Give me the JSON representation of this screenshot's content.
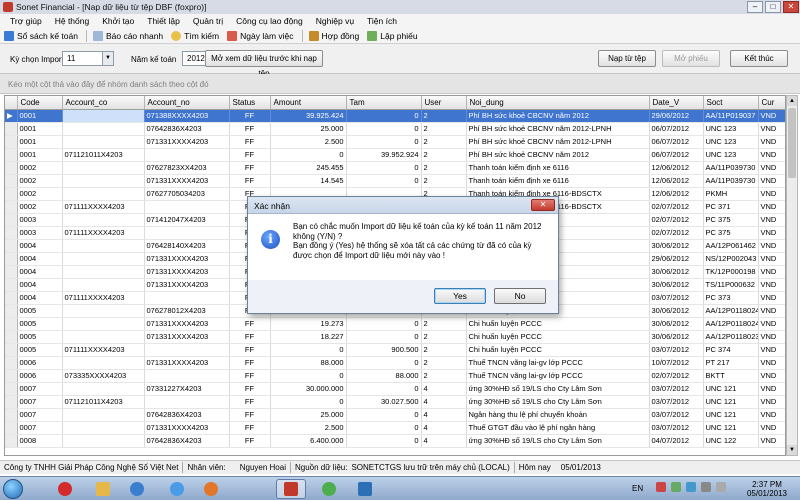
{
  "window": {
    "title": "Sonet Financial - [Nap dữ liệu từ tệp DBF (foxpro)]"
  },
  "menu": [
    "Trợ giúp",
    "Hệ thống",
    "Khởi tạo",
    "Thiết lập",
    "Quản trị",
    "Công cụ lao động",
    "Nghiệp vụ",
    "Tiện ích"
  ],
  "toolbar": [
    "Sổ sách kế toán",
    "Báo cáo nhanh",
    "Tìm kiếm",
    "Ngày làm việc",
    "Hợp đồng",
    "Lập phiếu"
  ],
  "filter": {
    "period_label": "Kỳ chọn Import",
    "period_value": "11",
    "year_label": "Năm kế toán",
    "year_value": "2012",
    "preview_button": "Mở xem dữ liệu trước khi nạp tệp",
    "import_button": "Nạp từ tệp",
    "open_button": "Mở phiếu",
    "close_button": "Kết thúc"
  },
  "group_hint": "Kéo một cột thả vào đây để nhóm danh sách theo cột đó",
  "grid": {
    "columns": [
      "Code",
      "Account_co",
      "Account_no",
      "Status",
      "Amount",
      "Tam",
      "User",
      "Noi_dung",
      "Date_V",
      "Soct",
      "Cur"
    ],
    "rows": [
      [
        "0001",
        "",
        "071388XXXX4203",
        "FF",
        "39.925.424",
        "0",
        "2",
        "Phí BH sức khoẻ CBCNV năm 2012",
        "29/06/2012",
        "AA/11P019037",
        "VND"
      ],
      [
        "0001",
        "",
        "07642836X4203",
        "FF",
        "25.000",
        "0",
        "2",
        "Phí BH sức khoẻ CBCNV năm 2012-LPNH",
        "06/07/2012",
        "UNC 123",
        "VND"
      ],
      [
        "0001",
        "",
        "071331XXXX4203",
        "FF",
        "2.500",
        "0",
        "2",
        "Phí BH sức khoẻ CBCNV năm 2012-LPNH",
        "06/07/2012",
        "UNC 123",
        "VND"
      ],
      [
        "0001",
        "071121011X4203",
        "",
        "FF",
        "0",
        "39.952.924",
        "2",
        "Phí BH sức khoẻ CBCNV năm 2012",
        "06/07/2012",
        "UNC 123",
        "VND"
      ],
      [
        "0002",
        "",
        "07627823XX4203",
        "FF",
        "245.455",
        "0",
        "2",
        "Thanh toán kiểm định xe 6116",
        "12/06/2012",
        "AA/11P039730",
        "VND"
      ],
      [
        "0002",
        "",
        "071331XXXX4203",
        "FF",
        "14.545",
        "0",
        "2",
        "Thanh toán kiểm định xe 6116",
        "12/06/2012",
        "AA/11P039730",
        "VND"
      ],
      [
        "0002",
        "",
        "07627705034203",
        "FF",
        "",
        "",
        "2",
        "Thanh toán kiểm định xe 6116-BDSCTX",
        "12/06/2012",
        "PKMH",
        "VND"
      ],
      [
        "0002",
        "071111XXXX4203",
        "",
        "FF",
        "",
        "",
        "2",
        "Thanh toán kiểm định xe 6116-BDSCTX",
        "02/07/2012",
        "PC 371",
        "VND"
      ],
      [
        "0003",
        "",
        "071412047X4203",
        "FF",
        "",
        "",
        "2",
        "Thanh toán phí thẻ VISA",
        "02/07/2012",
        "PC 375",
        "VND"
      ],
      [
        "0003",
        "071111XXXX4203",
        "",
        "FF",
        "",
        "",
        "2",
        "Thanh toán phí thẻ VISA",
        "02/07/2012",
        "PC 375",
        "VND"
      ],
      [
        "0004",
        "",
        "076428140X4203",
        "FF",
        "",
        "",
        "2",
        "Chi huấn luyện PCCC",
        "30/06/2012",
        "AA/12P061462",
        "VND"
      ],
      [
        "0004",
        "",
        "071331XXXX4203",
        "FF",
        "",
        "",
        "2",
        "Chi huấn luyện PCCC",
        "29/06/2012",
        "NS/12P002043",
        "VND"
      ],
      [
        "0004",
        "",
        "071331XXXX4203",
        "FF",
        "",
        "",
        "2",
        "Chi huấn luyện PCCC",
        "30/06/2012",
        "TK/12P000198",
        "VND"
      ],
      [
        "0004",
        "",
        "071331XXXX4203",
        "FF",
        "",
        "",
        "2",
        "Chi huấn luyện PCCC",
        "30/06/2012",
        "TS/11P000632",
        "VND"
      ],
      [
        "0004",
        "071111XXXX4203",
        "",
        "FF",
        "",
        "",
        "2",
        "Chi huấn luyện PCCC",
        "03/07/2012",
        "PC 373",
        "VND"
      ],
      [
        "0005",
        "",
        "076278012X4203",
        "FF",
        "",
        "",
        "2",
        "Chi huấn luyện PCCC",
        "30/06/2012",
        "AA/12P0118024",
        "VND"
      ],
      [
        "0005",
        "",
        "071331XXXX4203",
        "FF",
        "19.273",
        "0",
        "2",
        "Chi huấn luyện PCCC",
        "30/06/2012",
        "AA/12P0118024",
        "VND"
      ],
      [
        "0005",
        "",
        "071331XXXX4203",
        "FF",
        "18.227",
        "0",
        "2",
        "Chi huấn luyện PCCC",
        "30/06/2012",
        "AA/12P0118023",
        "VND"
      ],
      [
        "0005",
        "071111XXXX4203",
        "",
        "FF",
        "0",
        "900.500",
        "2",
        "Chi huấn luyện PCCC",
        "03/07/2012",
        "PC 374",
        "VND"
      ],
      [
        "0006",
        "",
        "071331XXXX4203",
        "FF",
        "88.000",
        "0",
        "2",
        "Thuế TNCN vãng lai-gv lớp PCCC",
        "10/07/2012",
        "PT 217",
        "VND"
      ],
      [
        "0006",
        "073335XXXX4203",
        "",
        "FF",
        "0",
        "88.000",
        "2",
        "Thuế TNCN vãng lai-gv lớp PCCC",
        "02/07/2012",
        "BKTT",
        "VND"
      ],
      [
        "0007",
        "",
        "07331227X4203",
        "FF",
        "30.000.000",
        "0",
        "4",
        "ứng 30%HĐ số 19/LS cho Cty Lâm Sơn",
        "03/07/2012",
        "UNC 121",
        "VND"
      ],
      [
        "0007",
        "071121011X4203",
        "",
        "FF",
        "0",
        "30.027.500",
        "4",
        "ứng 30%HĐ số 19/LS cho Cty Lâm Sơn",
        "03/07/2012",
        "UNC 121",
        "VND"
      ],
      [
        "0007",
        "",
        "07642836X4203",
        "FF",
        "25.000",
        "0",
        "4",
        "Ngân hàng thu lệ phí chuyển khoản",
        "03/07/2012",
        "UNC 121",
        "VND"
      ],
      [
        "0007",
        "",
        "071331XXXX4203",
        "FF",
        "2.500",
        "0",
        "4",
        "Thuế GTGT đầu vào lệ phí ngân hàng",
        "03/07/2012",
        "UNC 121",
        "VND"
      ],
      [
        "0008",
        "",
        "07642836X4203",
        "FF",
        "6.400.000",
        "0",
        "4",
        "ứng 30%HĐ số 19/LS cho Cty Lâm Sơn",
        "04/07/2012",
        "UNC 122",
        "VND"
      ]
    ]
  },
  "status": {
    "company": "Công ty TNHH Giải Pháp Công Nghệ Số Việt Net",
    "staff_label": "Nhân viên:",
    "staff_value": "Nguyen Hoai",
    "source_label": "Nguồn dữ liệu:",
    "source_value": "SONETCTGS lưu trữ trên máy chủ (LOCAL)",
    "today_label": "Hôm nay",
    "today_value": "05/01/2013"
  },
  "dialog": {
    "title": "Xác nhận",
    "message_1": "Bạn có chắc muốn Import dữ liệu kế toán của kỳ kế toán 11 năm 2012 không (Y/N) ?",
    "message_2": "Bạn đồng ý (Yes) hệ thống sẽ xóa tất cả các chứng từ đã có của kỳ được chọn để Import dữ liệu mới này vào !",
    "yes": "Yes",
    "no": "No"
  },
  "taskbar": {
    "language": "EN",
    "time": "2:37 PM",
    "date": "05/01/2013"
  },
  "colors": {
    "selection": "#3f74cf",
    "titlebar": "#d6dbe6",
    "dialog_bg": "#eef2f8"
  }
}
